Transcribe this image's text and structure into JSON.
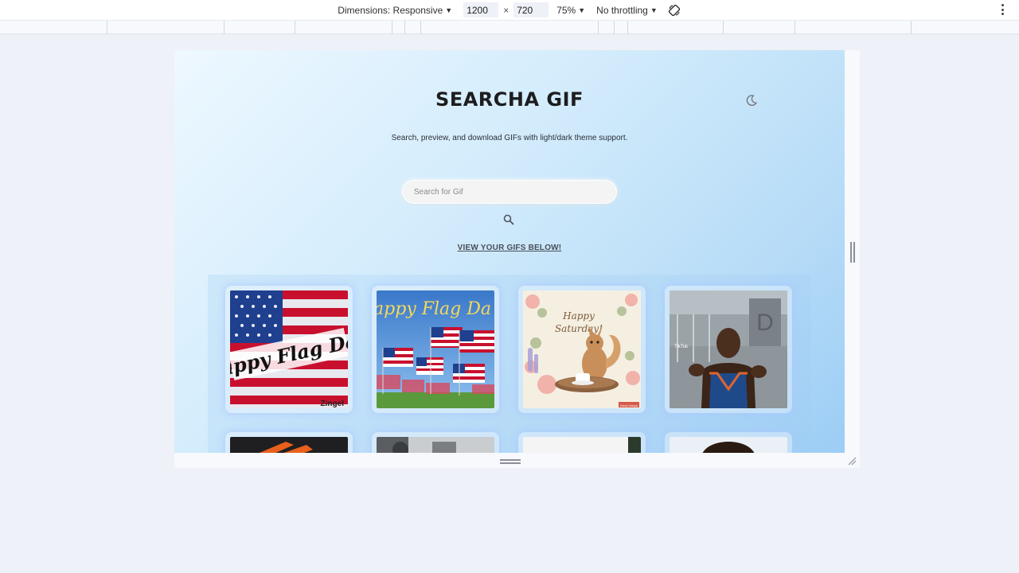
{
  "devtools": {
    "dimensions_label": "Dimensions: Responsive",
    "width_value": "1200",
    "times_symbol": "×",
    "height_value": "720",
    "zoom_label": "75%",
    "throttling_label": "No throttling",
    "icons": [
      "caret-down-icon",
      "rotate-icon",
      "more-vertical-icon"
    ]
  },
  "app": {
    "title": "SEARCHA GIF",
    "subtitle": "Search, preview, and download GIFs with light/dark theme support.",
    "search_placeholder": "Search for Gif",
    "view_link": "VIEW YOUR GIFS BELOW!",
    "icons": [
      "moon-icon",
      "search-icon"
    ]
  },
  "gifs": [
    {
      "id": "gif-1",
      "text": "Happy Flag Day",
      "watermark": "Zingel"
    },
    {
      "id": "gif-2",
      "text": "Happy Flag Day"
    },
    {
      "id": "gif-3",
      "text": "Happy Saturday!",
      "watermark": "Deva Hariya"
    },
    {
      "id": "gif-4",
      "watermark": "TikTok"
    },
    {
      "id": "gif-5"
    },
    {
      "id": "gif-6"
    },
    {
      "id": "gif-7"
    },
    {
      "id": "gif-8"
    }
  ],
  "colors": {
    "page_bg": "#eef1f7",
    "gradient_start": "#eef8ff",
    "gradient_end": "#9ccdf5",
    "card_glow": "#aac8ff",
    "title": "#1d1d1f"
  }
}
